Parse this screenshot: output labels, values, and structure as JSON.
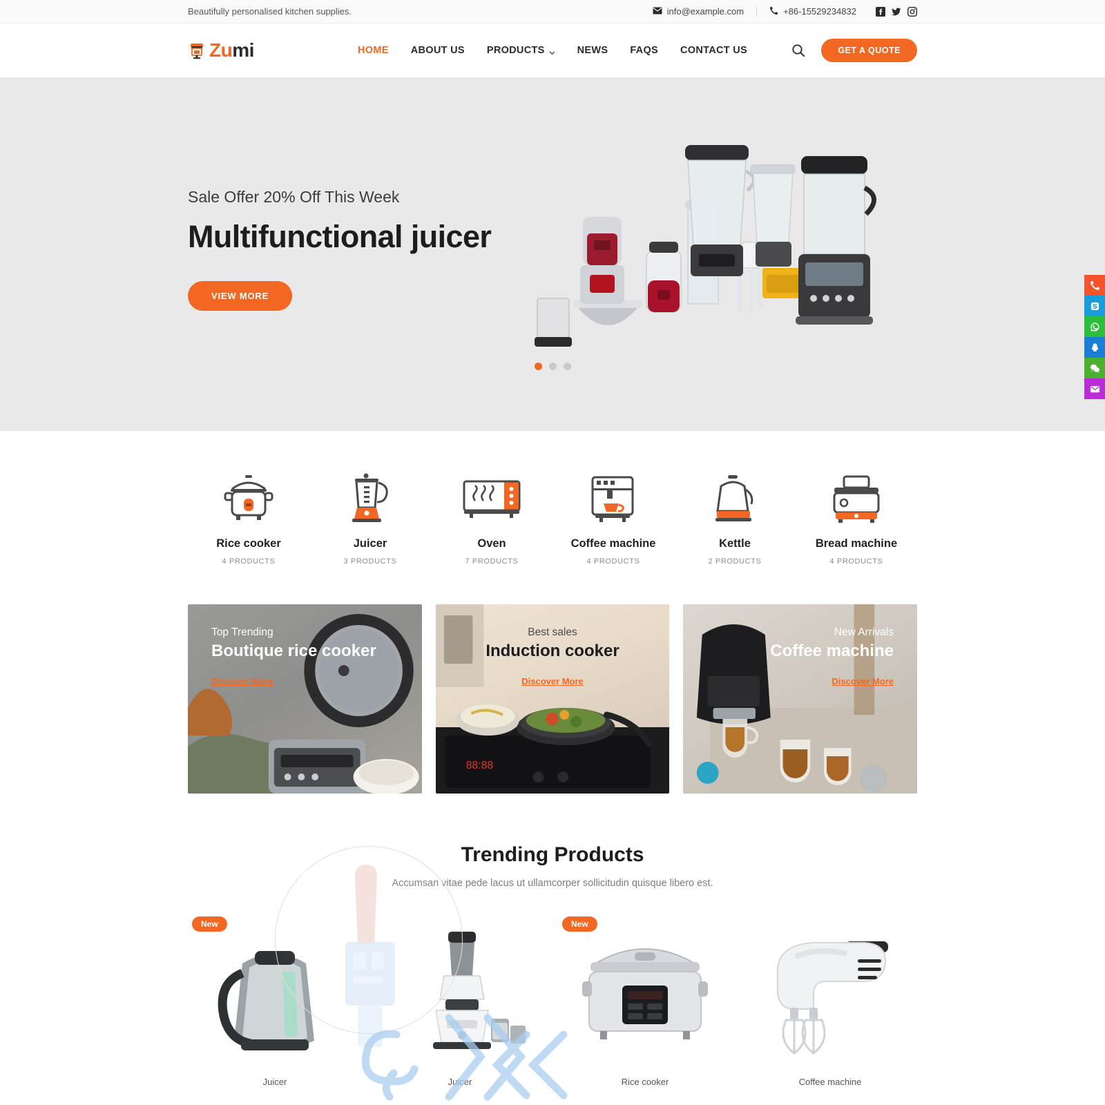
{
  "topbar": {
    "tagline": "Beautifully personalised kitchen supplies.",
    "email": "info@example.com",
    "phone": "+86-15529234832",
    "social": [
      {
        "name": "facebook-icon",
        "label": "Facebook"
      },
      {
        "name": "twitter-icon",
        "label": "Twitter"
      },
      {
        "name": "instagram-icon",
        "label": "Instagram"
      }
    ]
  },
  "header": {
    "logo": {
      "part1": "Zu",
      "part2": "mi",
      "mark": "storefront-icon"
    },
    "nav": [
      {
        "label": "HOME",
        "active": true,
        "dropdown": false
      },
      {
        "label": "ABOUT US",
        "active": false,
        "dropdown": false
      },
      {
        "label": "PRODUCTS",
        "active": false,
        "dropdown": true
      },
      {
        "label": "NEWS",
        "active": false,
        "dropdown": false
      },
      {
        "label": "FAQS",
        "active": false,
        "dropdown": false
      },
      {
        "label": "CONTACT US",
        "active": false,
        "dropdown": false
      }
    ],
    "search_icon": "search-icon",
    "quote_label": "GET A QUOTE"
  },
  "hero": {
    "kicker": "Sale Offer 20% Off This Week",
    "title": "Multifunctional juicer",
    "button": "VIEW MORE",
    "slides": 3,
    "active_slide": 1
  },
  "categories": [
    {
      "name": "Rice cooker",
      "count": "4 PRODUCTS",
      "icon": "rice-cooker-icon"
    },
    {
      "name": "Juicer",
      "count": "3 PRODUCTS",
      "icon": "blender-icon"
    },
    {
      "name": "Oven",
      "count": "7 PRODUCTS",
      "icon": "oven-icon"
    },
    {
      "name": "Coffee machine",
      "count": "4 PRODUCTS",
      "icon": "coffee-machine-icon"
    },
    {
      "name": "Kettle",
      "count": "2 PRODUCTS",
      "icon": "kettle-icon"
    },
    {
      "name": "Bread machine",
      "count": "4 PRODUCTS",
      "icon": "toaster-icon"
    }
  ],
  "banners": [
    {
      "kicker": "Top Trending",
      "title": "Boutique rice cooker",
      "link": "Discover More",
      "align": "left",
      "tone": "light"
    },
    {
      "kicker": "Best sales",
      "title": "Induction cooker",
      "link": "Discover More",
      "align": "center",
      "tone": "dark"
    },
    {
      "kicker": "New Arrivals",
      "title": "Coffee machine",
      "link": "Discover More",
      "align": "right",
      "tone": "light"
    }
  ],
  "trending": {
    "title": "Trending Products",
    "subtitle": "Accumsan vitae pede lacus ut ullamcorper sollicitudin quisque libero est.",
    "badge_new": "New",
    "products": [
      {
        "name": "Juicer",
        "badge": "New",
        "art": "kettle-photo"
      },
      {
        "name": "Juicer",
        "badge": "",
        "art": "blender-photo"
      },
      {
        "name": "Rice cooker",
        "badge": "New",
        "art": "rice-cooker-photo"
      },
      {
        "name": "Coffee machine",
        "badge": "",
        "art": "hand-mixer-photo"
      }
    ]
  },
  "side_rail": [
    {
      "name": "phone-icon",
      "color": "#f4542b"
    },
    {
      "name": "skype-icon",
      "color": "#179cde"
    },
    {
      "name": "whatsapp-icon",
      "color": "#2cbf3c"
    },
    {
      "name": "qq-icon",
      "color": "#1a7fd4"
    },
    {
      "name": "wechat-icon",
      "color": "#4caf2f"
    },
    {
      "name": "email-icon",
      "color": "#b92cd8"
    }
  ],
  "colors": {
    "accent": "#f26722",
    "hero_bg": "#e9e9e9",
    "text": "#222222"
  }
}
